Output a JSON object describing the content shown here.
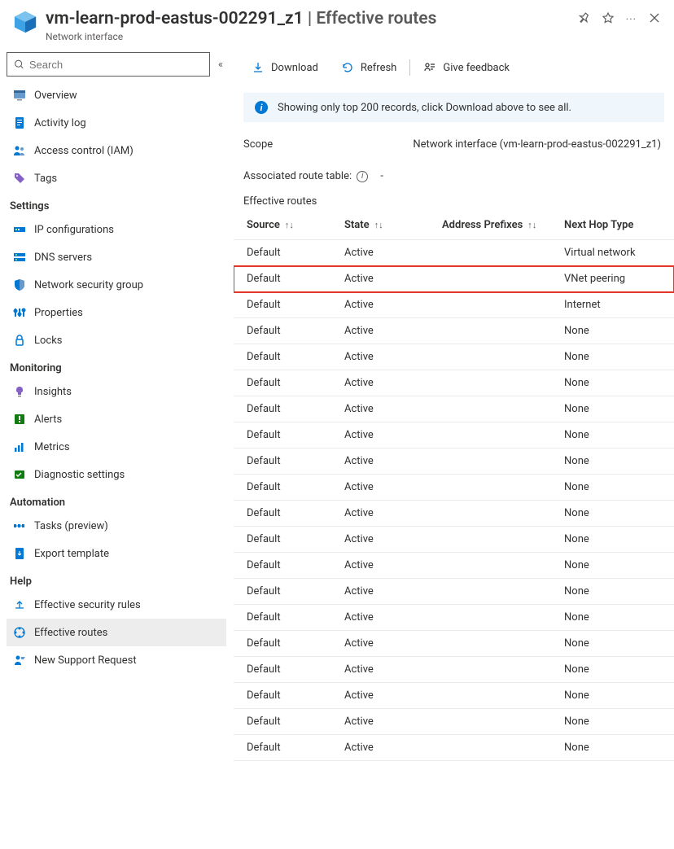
{
  "header": {
    "resource_name": "vm-learn-prod-eastus-002291_z1",
    "page_name": "Effective routes",
    "subtitle": "Network interface"
  },
  "search": {
    "placeholder": "Search"
  },
  "sidebar": {
    "top": [
      {
        "label": "Overview",
        "icon": "overview"
      },
      {
        "label": "Activity log",
        "icon": "activity"
      },
      {
        "label": "Access control (IAM)",
        "icon": "iam"
      },
      {
        "label": "Tags",
        "icon": "tags"
      }
    ],
    "groups": [
      {
        "title": "Settings",
        "items": [
          {
            "label": "IP configurations",
            "icon": "ipconfig"
          },
          {
            "label": "DNS servers",
            "icon": "dns"
          },
          {
            "label": "Network security group",
            "icon": "nsg"
          },
          {
            "label": "Properties",
            "icon": "props"
          },
          {
            "label": "Locks",
            "icon": "locks"
          }
        ]
      },
      {
        "title": "Monitoring",
        "items": [
          {
            "label": "Insights",
            "icon": "insights"
          },
          {
            "label": "Alerts",
            "icon": "alerts"
          },
          {
            "label": "Metrics",
            "icon": "metrics"
          },
          {
            "label": "Diagnostic settings",
            "icon": "diag"
          }
        ]
      },
      {
        "title": "Automation",
        "items": [
          {
            "label": "Tasks (preview)",
            "icon": "tasks"
          },
          {
            "label": "Export template",
            "icon": "export"
          }
        ]
      },
      {
        "title": "Help",
        "items": [
          {
            "label": "Effective security rules",
            "icon": "effsec"
          },
          {
            "label": "Effective routes",
            "icon": "effroutes",
            "selected": true
          },
          {
            "label": "New Support Request",
            "icon": "support"
          }
        ]
      }
    ]
  },
  "toolbar": {
    "download": "Download",
    "refresh": "Refresh",
    "feedback": "Give feedback"
  },
  "info_message": "Showing only top 200 records, click Download above to see all.",
  "scope": {
    "label": "Scope",
    "value": "Network interface (vm-learn-prod-eastus-002291_z1)"
  },
  "assoc": {
    "label": "Associated route table:",
    "value": "-"
  },
  "section_title": "Effective routes",
  "columns": {
    "source": "Source",
    "state": "State",
    "prefixes": "Address Prefixes",
    "nexthop": "Next Hop Type"
  },
  "routes": [
    {
      "source": "Default",
      "state": "Active",
      "prefixes": "",
      "nexthop": "Virtual network"
    },
    {
      "source": "Default",
      "state": "Active",
      "prefixes": "",
      "nexthop": "VNet peering",
      "highlight": true
    },
    {
      "source": "Default",
      "state": "Active",
      "prefixes": "",
      "nexthop": "Internet"
    },
    {
      "source": "Default",
      "state": "Active",
      "prefixes": "",
      "nexthop": "None"
    },
    {
      "source": "Default",
      "state": "Active",
      "prefixes": "",
      "nexthop": "None"
    },
    {
      "source": "Default",
      "state": "Active",
      "prefixes": "",
      "nexthop": "None"
    },
    {
      "source": "Default",
      "state": "Active",
      "prefixes": "",
      "nexthop": "None"
    },
    {
      "source": "Default",
      "state": "Active",
      "prefixes": "",
      "nexthop": "None"
    },
    {
      "source": "Default",
      "state": "Active",
      "prefixes": "",
      "nexthop": "None"
    },
    {
      "source": "Default",
      "state": "Active",
      "prefixes": "",
      "nexthop": "None"
    },
    {
      "source": "Default",
      "state": "Active",
      "prefixes": "",
      "nexthop": "None"
    },
    {
      "source": "Default",
      "state": "Active",
      "prefixes": "",
      "nexthop": "None"
    },
    {
      "source": "Default",
      "state": "Active",
      "prefixes": "",
      "nexthop": "None"
    },
    {
      "source": "Default",
      "state": "Active",
      "prefixes": "",
      "nexthop": "None"
    },
    {
      "source": "Default",
      "state": "Active",
      "prefixes": "",
      "nexthop": "None"
    },
    {
      "source": "Default",
      "state": "Active",
      "prefixes": "",
      "nexthop": "None"
    },
    {
      "source": "Default",
      "state": "Active",
      "prefixes": "",
      "nexthop": "None"
    },
    {
      "source": "Default",
      "state": "Active",
      "prefixes": "",
      "nexthop": "None"
    },
    {
      "source": "Default",
      "state": "Active",
      "prefixes": "",
      "nexthop": "None"
    },
    {
      "source": "Default",
      "state": "Active",
      "prefixes": "",
      "nexthop": "None"
    }
  ]
}
